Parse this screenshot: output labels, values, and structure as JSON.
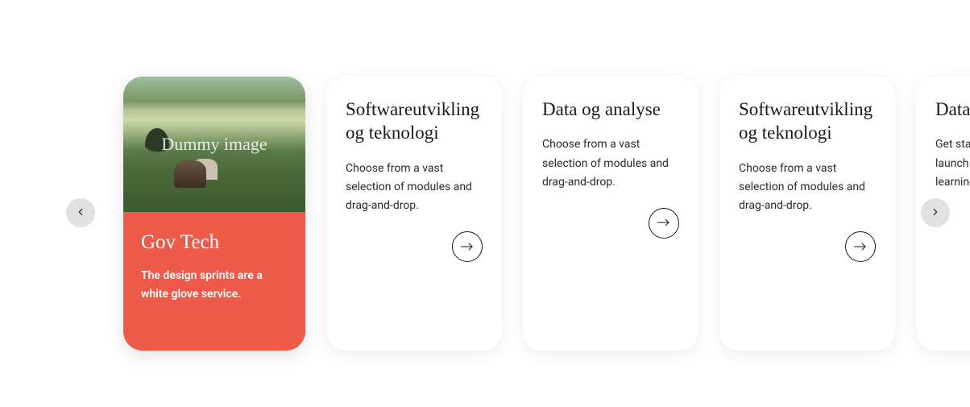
{
  "carousel": {
    "cards": [
      {
        "image_label": "Dummy image",
        "title": "Gov Tech",
        "description": "The design sprints are a white glove service."
      },
      {
        "title": "Softwareutvikling og teknologi",
        "description": "Choose from a vast selection of modules and drag-and-drop."
      },
      {
        "title": "Data og analyse",
        "description": "Choose from a vast selection of modules and drag-and-drop."
      },
      {
        "title": "Softwareutvikling og teknologi",
        "description": "Choose from a vast selection of modules and drag-and-drop."
      },
      {
        "title": "Data og analyse",
        "description": "Get started quickly and launch right away with our learning"
      }
    ]
  },
  "colors": {
    "accent": "#ed5a4a",
    "nav_button": "#e1e1e1"
  }
}
